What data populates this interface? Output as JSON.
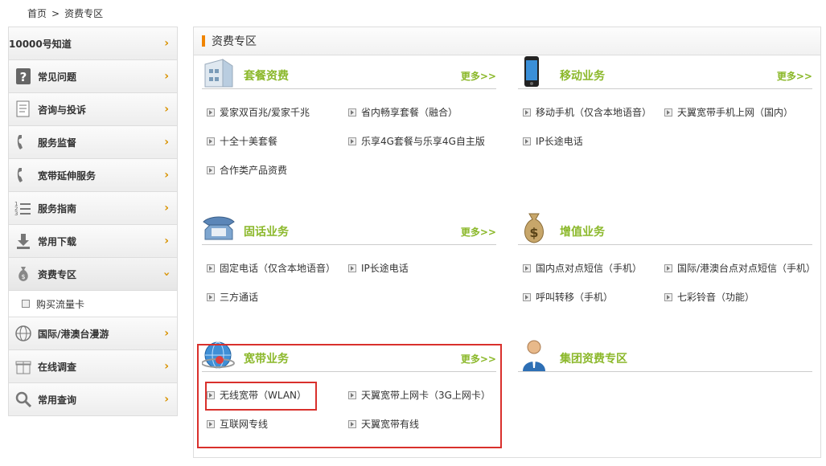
{
  "breadcrumb": {
    "home": "首页",
    "sep": ">",
    "current": "资费专区"
  },
  "sidebar": {
    "items": [
      {
        "label": "10000号知道",
        "icon": "none",
        "state": "collapsed"
      },
      {
        "label": "常见问题",
        "icon": "question-icon",
        "state": "collapsed"
      },
      {
        "label": "咨询与投诉",
        "icon": "document-icon",
        "state": "collapsed"
      },
      {
        "label": "服务监督",
        "icon": "phone-icon",
        "state": "collapsed"
      },
      {
        "label": "宽带延伸服务",
        "icon": "phone-icon",
        "state": "collapsed"
      },
      {
        "label": "服务指南",
        "icon": "list-icon",
        "state": "collapsed"
      },
      {
        "label": "常用下载",
        "icon": "download-icon",
        "state": "collapsed"
      },
      {
        "label": "资费专区",
        "icon": "money-bag-icon",
        "state": "expanded"
      },
      {
        "label": "国际/港澳台漫游",
        "icon": "globe-icon",
        "state": "collapsed"
      },
      {
        "label": "在线调查",
        "icon": "gift-icon",
        "state": "collapsed"
      },
      {
        "label": "常用查询",
        "icon": "search-icon",
        "state": "collapsed"
      }
    ],
    "subitems": [
      "购买流量卡"
    ]
  },
  "main": {
    "title": "资费专区",
    "more_label": "更多>>",
    "sections": [
      {
        "title": "套餐资费",
        "icon": "building-icon",
        "more": true,
        "links": [
          "爱家双百兆/爱家千兆",
          "省内畅享套餐（融合）",
          "十全十美套餐",
          "乐享4G套餐与乐享4G自主版",
          "合作类产品资费"
        ]
      },
      {
        "title": "移动业务",
        "icon": "mobile-phone-icon",
        "more": true,
        "links": [
          "移动手机（仅含本地语音）",
          "天翼宽带手机上网（国内）",
          "IP长途电话"
        ]
      },
      {
        "title": "固话业务",
        "icon": "desk-phone-icon",
        "more": true,
        "links": [
          "固定电话（仅含本地语音）",
          "IP长途电话",
          "三方通话"
        ]
      },
      {
        "title": "增值业务",
        "icon": "money-bag-icon",
        "more": false,
        "links": [
          "国内点对点短信（手机）",
          "国际/港澳台点对点短信（手机）",
          "呼叫转移（手机）",
          "七彩铃音（功能）"
        ]
      },
      {
        "title": "宽带业务",
        "icon": "globe-network-icon",
        "more": true,
        "links": [
          "无线宽带（WLAN）",
          "天翼宽带上网卡（3G上网卡）",
          "互联网专线",
          "天翼宽带有线"
        ]
      },
      {
        "title": "集团资费专区",
        "icon": "business-person-icon",
        "more": false,
        "links": []
      }
    ]
  },
  "colors": {
    "accent_green": "#8bb82a",
    "arrow_orange": "#d89200",
    "highlight_red": "#d9302c",
    "title_bar_orange": "#f08400"
  }
}
